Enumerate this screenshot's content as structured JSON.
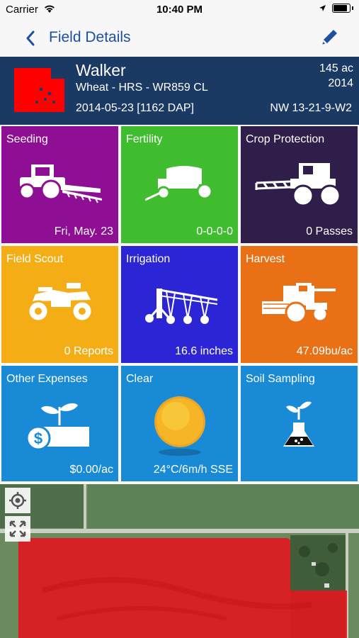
{
  "status": {
    "carrier": "Carrier",
    "time": "10:40 PM"
  },
  "nav": {
    "title": "Field Details"
  },
  "field": {
    "name": "Walker",
    "crop": "Wheat - HRS - WR859 CL",
    "date": "2014-05-23 [1162 DAP]",
    "acres": "145 ac",
    "year": "2014",
    "legal": "NW 13-21-9-W2"
  },
  "tiles": [
    {
      "label": "Seeding",
      "value": "Fri, May. 23",
      "color": "#8e0f93",
      "icon": "seeder-tractor-icon"
    },
    {
      "label": "Fertility",
      "value": "0-0-0-0",
      "color": "#3fbd2f",
      "icon": "fertilizer-spreader-icon"
    },
    {
      "label": "Crop Protection",
      "value": "0 Passes",
      "color": "#2f1d4a",
      "icon": "sprayer-icon"
    },
    {
      "label": "Field Scout",
      "value": "0 Reports",
      "color": "#f5ad16",
      "icon": "atv-icon"
    },
    {
      "label": "Irrigation",
      "value": "16.6 inches",
      "color": "#2c25d6",
      "icon": "pivot-irrigation-icon"
    },
    {
      "label": "Harvest",
      "value": "47.09bu/ac",
      "color": "#ea7016",
      "icon": "combine-icon"
    },
    {
      "label": "Other Expenses",
      "value": "$0.00/ac",
      "color": "#198ad6",
      "icon": "money-plant-icon"
    },
    {
      "label": "Clear",
      "value": "24°C/6m/h SSE",
      "color": "#198ad6",
      "icon": "sun-icon"
    },
    {
      "label": "Soil Sampling",
      "value": "",
      "color": "#198ad6",
      "icon": "flask-plant-icon"
    }
  ],
  "colors": {
    "header_bg": "#1b3a63",
    "nav_tint": "#1e4fa0",
    "field_red": "#ff0000"
  }
}
